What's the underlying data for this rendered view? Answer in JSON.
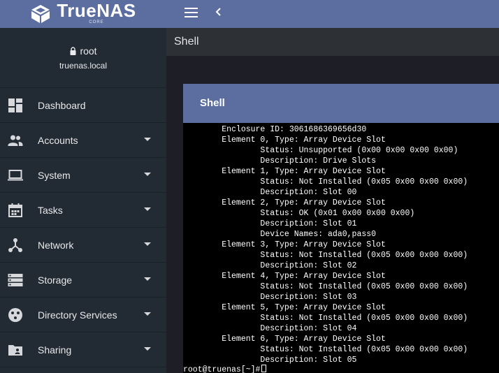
{
  "app": {
    "logo_name": "TrueNAS",
    "logo_sub": "CORE",
    "brand_color": "#5b6e9f"
  },
  "user": {
    "name": "root",
    "host": "truenas.local"
  },
  "sidebar": {
    "items": [
      {
        "label": "Dashboard",
        "icon": "dashboard-icon",
        "expandable": false
      },
      {
        "label": "Accounts",
        "icon": "accounts-icon",
        "expandable": true
      },
      {
        "label": "System",
        "icon": "laptop-icon",
        "expandable": true
      },
      {
        "label": "Tasks",
        "icon": "calendar-icon",
        "expandable": true
      },
      {
        "label": "Network",
        "icon": "network-icon",
        "expandable": true
      },
      {
        "label": "Storage",
        "icon": "storage-icon",
        "expandable": true
      },
      {
        "label": "Directory Services",
        "icon": "directory-services-icon",
        "expandable": true
      },
      {
        "label": "Sharing",
        "icon": "folder-share-icon",
        "expandable": true
      }
    ]
  },
  "page": {
    "title": "Shell"
  },
  "shell": {
    "title": "Shell",
    "lines": [
      "        Enclosure ID: 3061686369656d30",
      "        Element 0, Type: Array Device Slot",
      "                Status: Unsupported (0x00 0x00 0x00 0x00)",
      "                Description: Drive Slots",
      "        Element 1, Type: Array Device Slot",
      "                Status: Not Installed (0x05 0x00 0x00 0x00)",
      "                Description: Slot 00",
      "        Element 2, Type: Array Device Slot",
      "                Status: OK (0x01 0x00 0x00 0x00)",
      "                Description: Slot 01",
      "                Device Names: ada0,pass0",
      "        Element 3, Type: Array Device Slot",
      "                Status: Not Installed (0x05 0x00 0x00 0x00)",
      "                Description: Slot 02",
      "        Element 4, Type: Array Device Slot",
      "                Status: Not Installed (0x05 0x00 0x00 0x00)",
      "                Description: Slot 03",
      "        Element 5, Type: Array Device Slot",
      "                Status: Not Installed (0x05 0x00 0x00 0x00)",
      "                Description: Slot 04",
      "        Element 6, Type: Array Device Slot",
      "                Status: Not Installed (0x05 0x00 0x00 0x00)",
      "                Description: Slot 05"
    ],
    "prompt": "root@truenas[~]#"
  }
}
